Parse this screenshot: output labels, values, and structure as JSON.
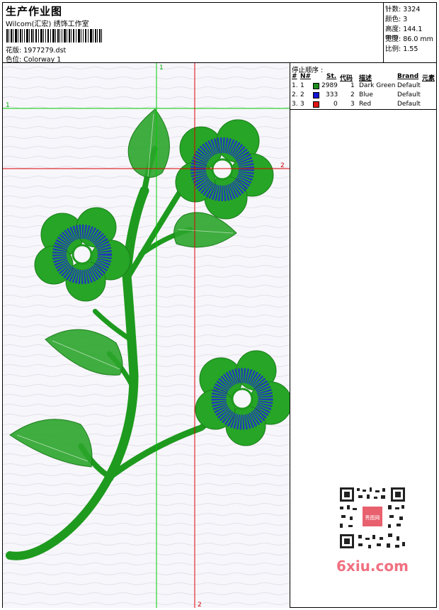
{
  "header": {
    "title": "生产作业图",
    "subtitle": "Wilcom(汇宏) 绣饰工作室",
    "design_label": "花版: 1977279.dst",
    "colorway_label": "色位: Colorway 1"
  },
  "stats": {
    "stitches": "针数: 3324",
    "colors": "颜色: 3",
    "height": "高度: 144.1 mm",
    "width": "宽度: 86.0 mm",
    "scale": "比例: 1.55"
  },
  "guides": {
    "v1": "1",
    "h1": "1",
    "h2": "2",
    "v2": "2"
  },
  "thread_panel": {
    "title": "停止顺序 :",
    "columns": [
      "#",
      "N#",
      "St.",
      "代码",
      "描述",
      "Brand",
      "元素"
    ],
    "rows": [
      {
        "num": "1.",
        "n": "1",
        "color": "#1e8c1e",
        "stitches": "2989",
        "code": "1",
        "desc": "Dark Green",
        "brand": "Default"
      },
      {
        "num": "2.",
        "n": "2",
        "color": "#1414d2",
        "stitches": "333",
        "code": "2",
        "desc": "Blue",
        "brand": "Default"
      },
      {
        "num": "3.",
        "n": "3",
        "color": "#e01414",
        "stitches": "0",
        "code": "3",
        "desc": "Red",
        "brand": "Default"
      }
    ]
  },
  "watermark": "6xiu.com",
  "qr_badge": "秀图网",
  "colors": {
    "stitch_green": "#1e9a1e",
    "stitch_blue": "#1e2ad2",
    "guide_green": "#00cc00",
    "guide_red": "#dd0000",
    "canvas_bg": "#f7f6fb"
  }
}
